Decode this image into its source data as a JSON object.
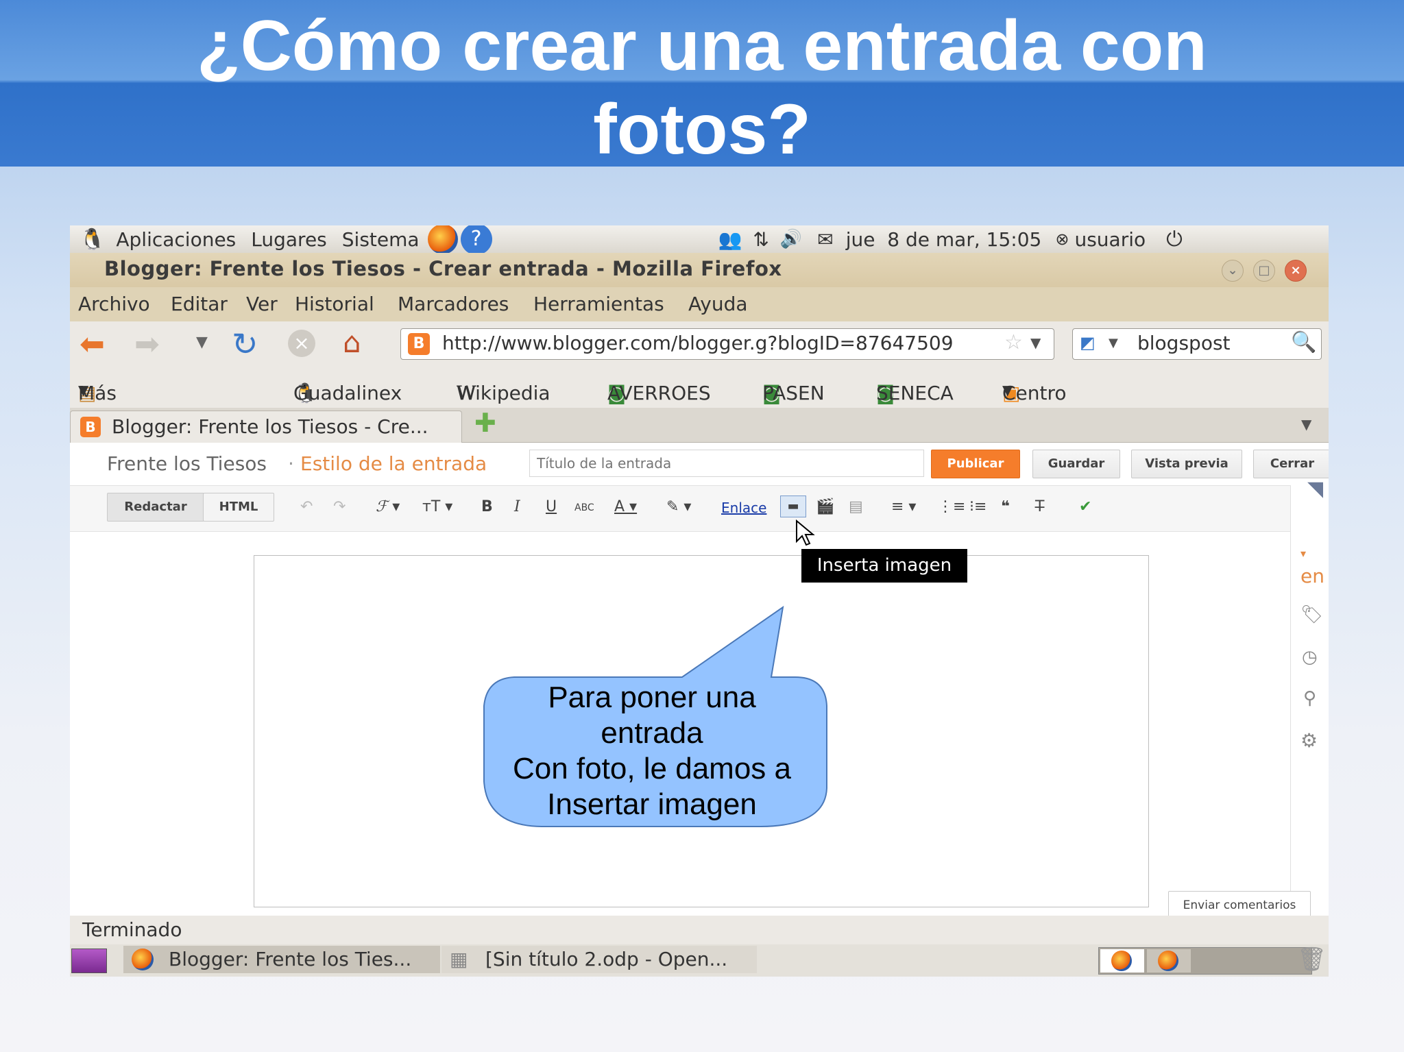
{
  "slide": {
    "title_line1": "¿Cómo crear una entrada con",
    "title_line2": "fotos?"
  },
  "panel": {
    "menus": [
      "Aplicaciones",
      "Lugares",
      "Sistema"
    ],
    "datetime": "jue  8 de mar, 15:05",
    "user": "usuario"
  },
  "window": {
    "title": "Blogger: Frente los Tiesos - Crear entrada - Mozilla Firefox"
  },
  "menubar": {
    "items": [
      "Archivo",
      "Editar",
      "Ver",
      "Historial",
      "Marcadores",
      "Herramientas",
      "Ayuda"
    ]
  },
  "navbar": {
    "url": "http://www.blogger.com/blogger.g?blogID=87647509",
    "search": "blogspost"
  },
  "bookmarks": [
    "Más visitados",
    "Guadalinex",
    "Wikipedia",
    "AVERROES",
    "PASEN",
    "SENECA",
    "Centro de Gestió..."
  ],
  "tab": {
    "label": "Blogger: Frente los Tiesos - Cre..."
  },
  "blogger": {
    "blog_name": "Frente los Tiesos",
    "separator": "·",
    "page": "Estilo de la entrada",
    "title_placeholder": "Título de la entrada",
    "publish": "Publicar",
    "save": "Guardar",
    "preview": "Vista previa",
    "close": "Cerrar",
    "mode_compose": "Redactar",
    "mode_html": "HTML",
    "link": "Enlace",
    "tooltip": "Inserta imagen",
    "feedback": "Enviar comentarios",
    "sidebar_partial": "en"
  },
  "callout": {
    "line1": "Para poner una",
    "line2": "entrada",
    "line3": "Con foto, le damos a",
    "line4": "Insertar imagen"
  },
  "statusbar": {
    "text": "Terminado"
  },
  "taskbar": {
    "items": [
      "Blogger: Frente los Ties...",
      "[Sin título 2.odp - Open..."
    ]
  },
  "colors": {
    "publish": "#f57d2b",
    "blogger_accent": "#e58b45",
    "firefox_frame": "#dfd3b6"
  }
}
